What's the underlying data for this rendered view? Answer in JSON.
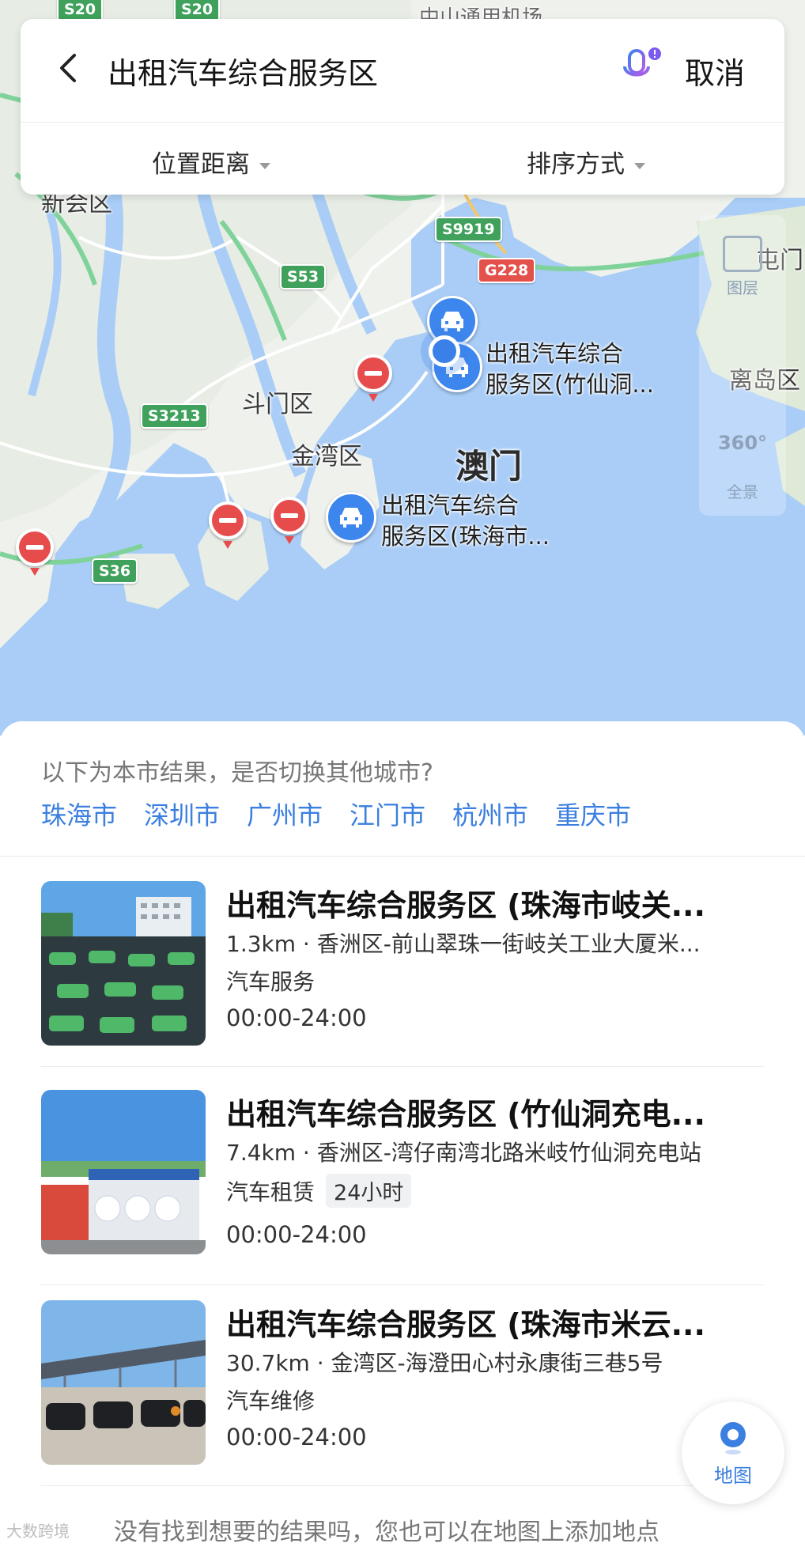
{
  "map": {
    "road_badges": [
      {
        "id": "S20a",
        "text": "S20",
        "color": "green"
      },
      {
        "id": "S20b",
        "text": "S20",
        "color": "green"
      },
      {
        "id": "S9919",
        "text": "S9919",
        "color": "green"
      },
      {
        "id": "G228",
        "text": "G228",
        "color": "red"
      },
      {
        "id": "S53",
        "text": "S53",
        "color": "green"
      },
      {
        "id": "S3213",
        "text": "S3213",
        "color": "green"
      },
      {
        "id": "S36",
        "text": "S36",
        "color": "green"
      }
    ],
    "labels": {
      "airport": "中山通用机场",
      "xinhui": "新会区",
      "doumen": "斗门区",
      "jinwan": "金湾区",
      "macau": "澳门",
      "ludao": "离岛区",
      "zhunmen": "屯门"
    },
    "poi_1": {
      "line1": "出租汽车综合",
      "line2": "服务区(竹仙洞..."
    },
    "poi_2": {
      "line1": "出租汽车综合",
      "line2": "服务区(珠海市..."
    },
    "side_controls": {
      "layers": "图层",
      "panorama_top": "360°",
      "panorama": "全景"
    },
    "colors": {
      "water": "#a9cdf7",
      "land": "#eef1ec",
      "road": "#ffffff",
      "highway": "#7fd39a",
      "pin": "#3d86ee",
      "no_entry": "#e74c4c"
    }
  },
  "search": {
    "query": "出租汽车综合服务区",
    "cancel_label": "取消",
    "filters": [
      {
        "label": "位置距离"
      },
      {
        "label": "排序方式"
      }
    ]
  },
  "city_switch": {
    "prompt": "以下为本市结果，是否切换其他城市?",
    "cities": [
      "珠海市",
      "深圳市",
      "广州市",
      "江门市",
      "杭州市",
      "重庆市"
    ]
  },
  "results": [
    {
      "title": "出租汽车综合服务区 (珠海市岐关...",
      "address": "1.3km · 香洲区-前山翠珠一街岐关工业大厦米...",
      "category": "汽车服务",
      "tag": "",
      "hours": "00:00-24:00"
    },
    {
      "title": "出租汽车综合服务区 (竹仙洞充电...",
      "address": "7.4km · 香洲区-湾仔南湾北路米岐竹仙洞充电站",
      "category": "汽车租赁",
      "tag": "24小时",
      "hours": "00:00-24:00"
    },
    {
      "title": "出租汽车综合服务区 (珠海市米云...",
      "address": "30.7km · 金湾区-海澄田心村永康街三巷5号",
      "category": "汽车维修",
      "tag": "",
      "hours": "00:00-24:00"
    }
  ],
  "footer_note": "没有找到想要的结果吗，您也可以在地图上添加地点",
  "map_button_label": "地图",
  "watermark": "大数跨境"
}
